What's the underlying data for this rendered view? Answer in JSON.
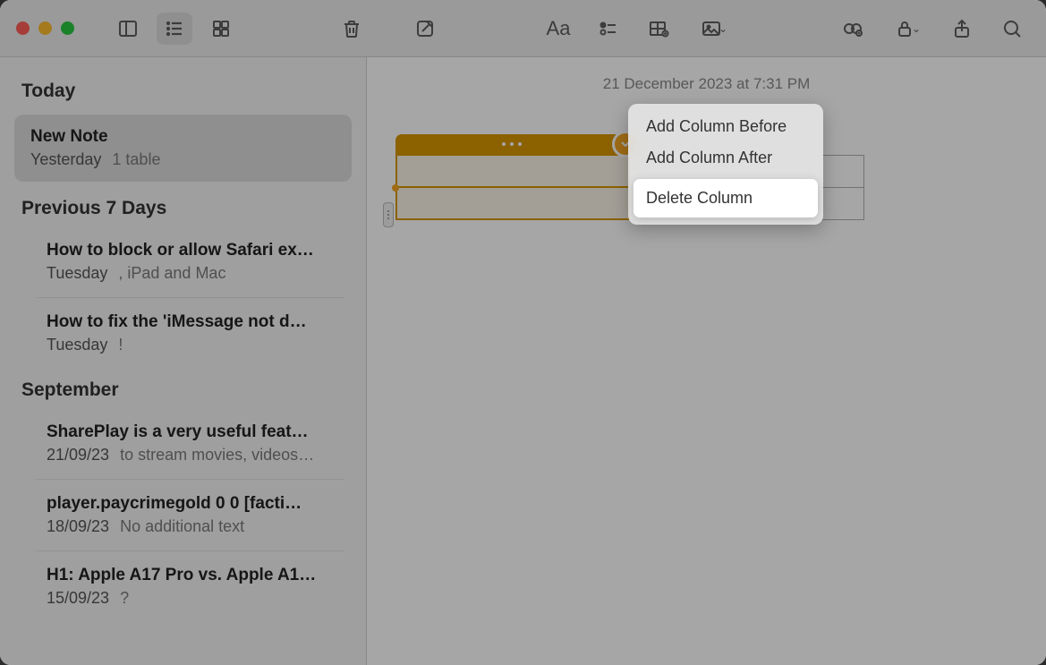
{
  "timestamp": "21 December 2023 at 7:31 PM",
  "sidebar": {
    "sections": [
      {
        "header": "Today",
        "card": {
          "title": "New Note",
          "date": "Yesterday",
          "preview": "1 table"
        }
      },
      {
        "header": "Previous 7 Days",
        "notes": [
          {
            "title": "How to block or allow Safari ex…",
            "date": "Tuesday",
            "preview": ", iPad and Mac"
          },
          {
            "title": "How to fix the 'iMessage not d…",
            "date": "Tuesday",
            "preview": "!"
          }
        ]
      },
      {
        "header": "September",
        "notes": [
          {
            "title": "SharePlay is a very useful feat…",
            "date": "21/09/23",
            "preview": "to stream movies, videos…"
          },
          {
            "title": "player.paycrimegold 0 0 [facti…",
            "date": "18/09/23",
            "preview": "No additional text"
          },
          {
            "title": "H1: Apple A17 Pro vs. Apple A1…",
            "date": "15/09/23",
            "preview": "?"
          }
        ]
      }
    ]
  },
  "contextMenu": {
    "items": [
      "Add Column Before",
      "Add Column After",
      "Delete Column"
    ]
  }
}
